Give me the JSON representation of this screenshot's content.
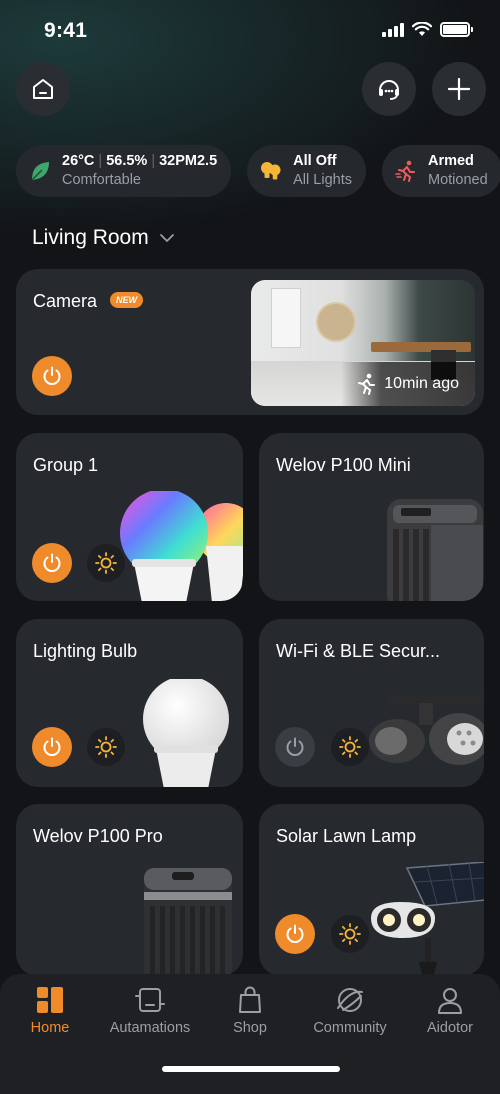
{
  "status_bar": {
    "time": "9:41"
  },
  "chips": [
    {
      "icon": "leaf-icon",
      "temperature": "26°C",
      "humidity": "56.5%",
      "pm": "32PM2.5",
      "subtitle": "Comfortable"
    },
    {
      "icon": "bulbs-icon",
      "title": "All Off",
      "subtitle": "All Lights"
    },
    {
      "icon": "running-person-icon",
      "title": "Armed",
      "subtitle": "Motioned"
    }
  ],
  "room": {
    "name": "Living Room"
  },
  "camera_card": {
    "title": "Camera",
    "badge": "NEW",
    "event_time": "10min ago"
  },
  "devices": [
    {
      "title": "Group 1"
    },
    {
      "title": "Welov P100 Mini"
    },
    {
      "title": "Lighting Bulb"
    },
    {
      "title": "Wi-Fi & BLE Secur..."
    },
    {
      "title": "Welov P100 Pro"
    },
    {
      "title": "Solar Lawn Lamp"
    }
  ],
  "nav": [
    {
      "label": "Home",
      "active": true
    },
    {
      "label": "Autamations"
    },
    {
      "label": "Shop"
    },
    {
      "label": "Community"
    },
    {
      "label": "Aidotor"
    }
  ],
  "colors": {
    "accent": "#f08b2b",
    "card": "#26292e",
    "background": "#121417"
  }
}
